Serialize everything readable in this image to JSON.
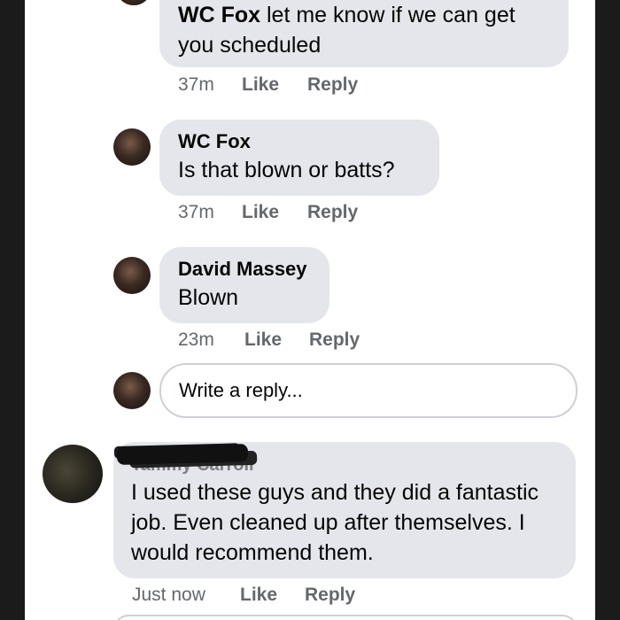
{
  "comments": [
    {
      "name": "WC Fox",
      "text": "let me know if we can get you scheduled",
      "time": "37m",
      "like": "Like",
      "reply": "Reply"
    },
    {
      "name": "WC Fox",
      "text": "Is that blown or batts?",
      "time": "37m",
      "like": "Like",
      "reply": "Reply"
    },
    {
      "name": "David Massey",
      "text": "Blown",
      "time": "23m",
      "like": "Like",
      "reply": "Reply"
    }
  ],
  "reply_input": {
    "placeholder": "Write a reply..."
  },
  "top_comment": {
    "name": "Tammy Carroll",
    "text": "I used these guys and they did a fantastic job. Even cleaned up after themselves. I would recommend them.",
    "time": "Just now",
    "like": "Like",
    "reply": "Reply"
  },
  "colors": {
    "bubble": "#e4e6eb",
    "action_text": "#65676b",
    "frame": "#1b1b1b"
  }
}
